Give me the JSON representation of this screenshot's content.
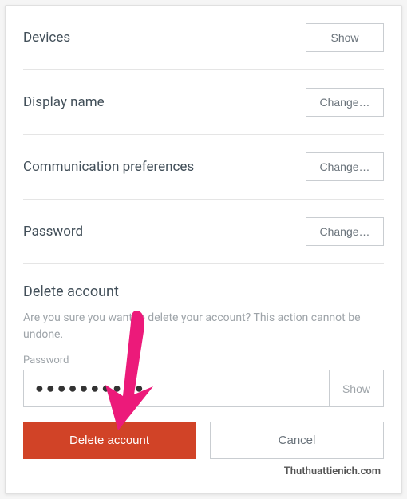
{
  "rows": [
    {
      "label": "Devices",
      "button": "Show"
    },
    {
      "label": "Display name",
      "button": "Change…"
    },
    {
      "label": "Communication preferences",
      "button": "Change…"
    },
    {
      "label": "Password",
      "button": "Change…"
    }
  ],
  "delete": {
    "heading": "Delete account",
    "warning": "Are you sure you want to delete your account? This action cannot be undone.",
    "pw_label": "Password",
    "pw_value": "●●●●●●●●●●",
    "show_label": "Show",
    "confirm_label": "Delete account",
    "cancel_label": "Cancel"
  },
  "watermark": "Thuthuattienich.com",
  "annotation": {
    "arrow_color": "#ec1a7a"
  }
}
